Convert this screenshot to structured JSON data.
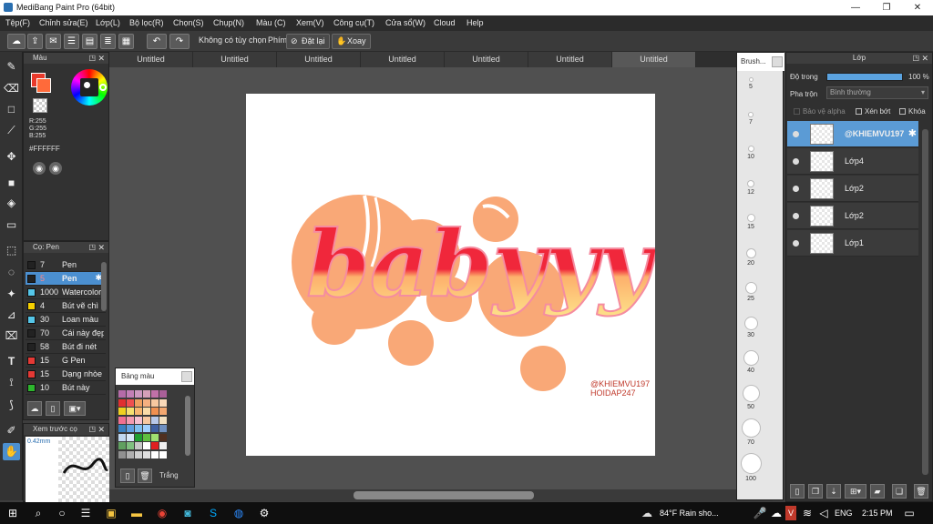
{
  "window": {
    "title": "MediBang Paint Pro (64bit)",
    "minimize": "—",
    "restore": "❐",
    "close": "✕"
  },
  "menu": [
    "Tệp(F)",
    "Chỉnh sửa(E)",
    "Lớp(L)",
    "Bộ lọc(R)",
    "Chọn(S)",
    "Chụp(N)",
    "Màu (C)",
    "Xem(V)",
    "Công cụ(T)",
    "Cửa sổ(W)",
    "Cloud",
    "Help"
  ],
  "toolbar": {
    "no_option": "Không có tùy chọn",
    "key_label": "Phím",
    "reset_label": "Đặt lại",
    "rotate_label": "Xoay"
  },
  "color_panel": {
    "title": "Màu",
    "r": "R:255",
    "g": "G:255",
    "b": "B:255",
    "hex": "#FFFFFF",
    "fg_color": "#e8392b",
    "accent": "#ff6a3a"
  },
  "brush_panel": {
    "title": "Cọ: Pen",
    "items": [
      {
        "size": "7",
        "name": "Pen",
        "color": "#222222"
      },
      {
        "size": "5",
        "name": "Pen",
        "color": "#222222",
        "selected": true
      },
      {
        "size": "1000",
        "name": "Watercolor",
        "color": "#55c6e8"
      },
      {
        "size": "4",
        "name": "Bút vẽ chì",
        "color": "#f5d000"
      },
      {
        "size": "30",
        "name": "Loan màu",
        "color": "#55c6e8"
      },
      {
        "size": "70",
        "name": "Cái này đẹp",
        "color": "#222222"
      },
      {
        "size": "58",
        "name": "Bút đi nét",
        "color": "#222222"
      },
      {
        "size": "15",
        "name": "G Pen",
        "color": "#e53935"
      },
      {
        "size": "15",
        "name": "Dạng nhòe",
        "color": "#e53935"
      },
      {
        "size": "10",
        "name": "Bút này",
        "color": "#2db52d"
      }
    ]
  },
  "preview_panel": {
    "title": "Xem trước cọ",
    "size": "0.42mm"
  },
  "palette_panel": {
    "title": "Bảng màu",
    "selected_label": "Trắng"
  },
  "tabs": [
    "Untitled",
    "Untitled",
    "Untitled",
    "Untitled",
    "Untitled",
    "Untitled",
    "Untitled"
  ],
  "artwork": {
    "text": "babyyy",
    "credit1": "@KHIEMVU197",
    "credit2": "HOIDAP247",
    "credit_color": "#c0392b"
  },
  "brush_size_panel": {
    "title": "Brush...",
    "sizes": [
      "5",
      "7",
      "10",
      "12",
      "15",
      "20",
      "25",
      "30",
      "40",
      "50",
      "70",
      "100"
    ]
  },
  "layer_panel": {
    "title": "Lớp",
    "opacity_label": "Độ trong",
    "opacity_value": "100 %",
    "blend_label": "Pha trộn",
    "blend_value": "Bình thường",
    "protect_alpha": "Bảo vệ alpha",
    "clipping": "Xén bớt",
    "lock": "Khóa",
    "layers": [
      {
        "name": "@KHIEMVU197",
        "selected": true
      },
      {
        "name": "Lớp4",
        "selected": false
      },
      {
        "name": "Lớp2",
        "selected": false
      },
      {
        "name": "Lớp2",
        "selected": false
      },
      {
        "name": "Lớp1",
        "selected": false
      }
    ]
  },
  "taskbar": {
    "weather": "84°F  Rain sho...",
    "lang": "ENG",
    "time": "2:15 PM"
  }
}
